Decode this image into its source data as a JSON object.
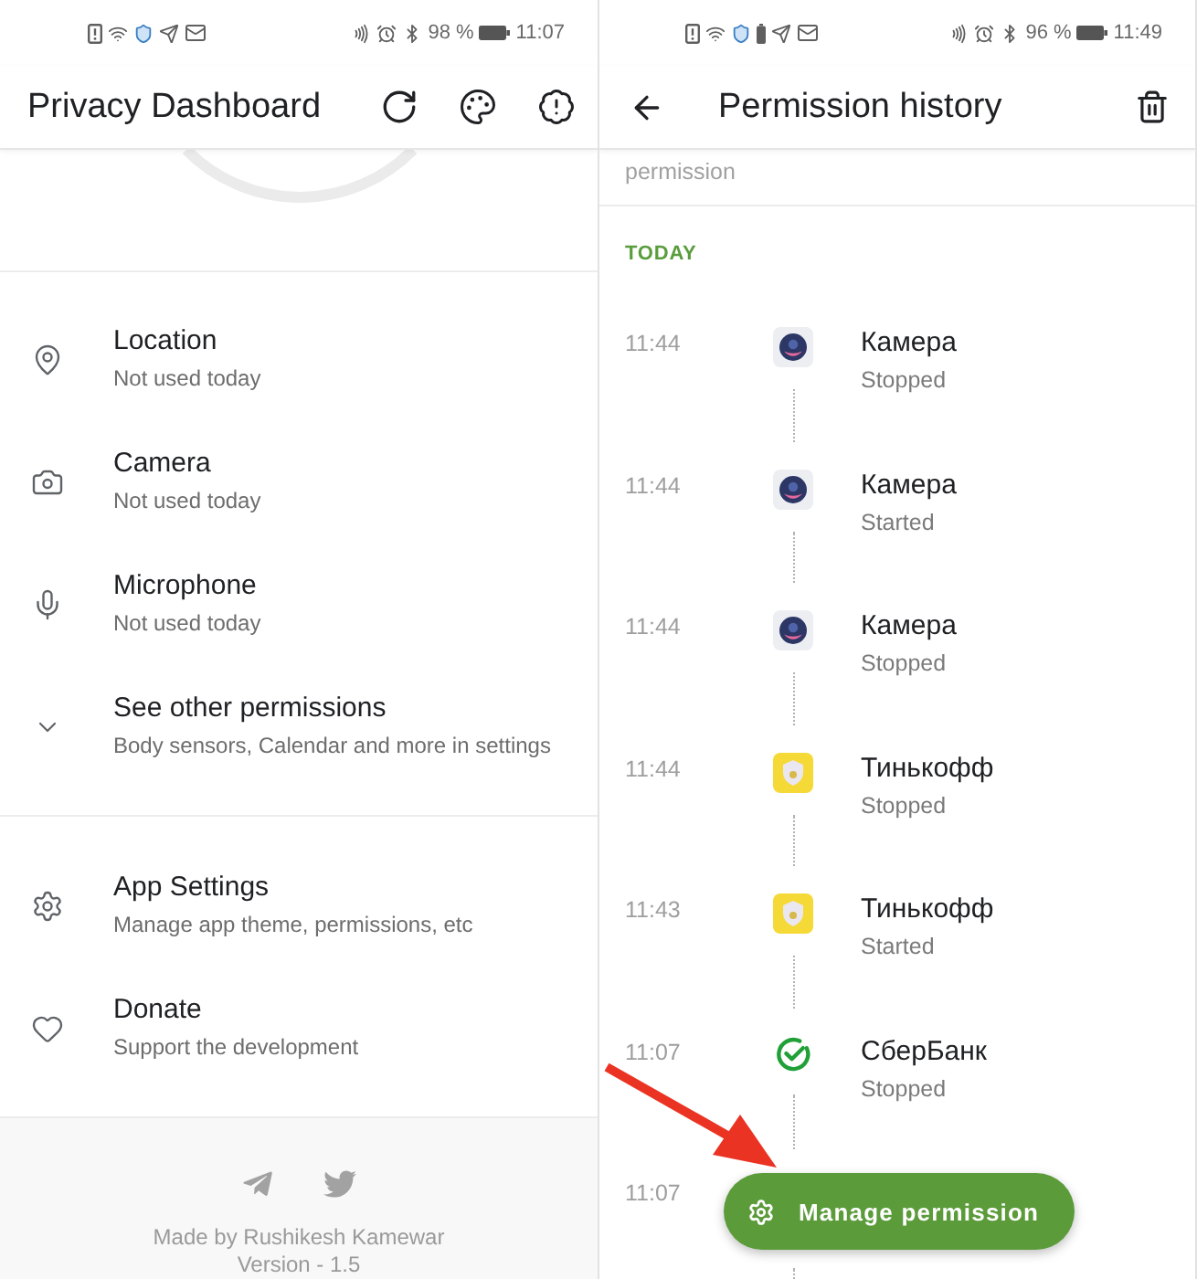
{
  "dashboard": {
    "status_bar": {
      "battery": "98 %",
      "time": "11:07"
    },
    "app_bar": {
      "title": "Privacy Dashboard"
    },
    "permissions": [
      {
        "title": "Location",
        "subtitle": "Not used today"
      },
      {
        "title": "Camera",
        "subtitle": "Not used today"
      },
      {
        "title": "Microphone",
        "subtitle": "Not used today"
      },
      {
        "title": "See other permissions",
        "subtitle": "Body sensors, Calendar and more in settings"
      }
    ],
    "settings": [
      {
        "title": "App Settings",
        "subtitle": "Manage app theme, permissions, etc"
      },
      {
        "title": "Donate",
        "subtitle": "Support the development"
      }
    ],
    "footer": {
      "credit": "Made by Rushikesh Kamewar",
      "version": "Version - 1.5"
    }
  },
  "history": {
    "status_bar": {
      "battery": "96 %",
      "time": "11:49"
    },
    "app_bar": {
      "title": "Permission history"
    },
    "previous_item": {
      "text": "permission"
    },
    "section": "TODAY",
    "events": [
      {
        "time": "11:44",
        "app": "Камера",
        "status": "Stopped"
      },
      {
        "time": "11:44",
        "app": "Камера",
        "status": "Started"
      },
      {
        "time": "11:44",
        "app": "Камера",
        "status": "Stopped"
      },
      {
        "time": "11:44",
        "app": "Тинькофф",
        "status": "Stopped"
      },
      {
        "time": "11:43",
        "app": "Тинькофф",
        "status": "Started"
      },
      {
        "time": "11:07",
        "app": "СберБанк",
        "status": "Stopped"
      },
      {
        "time": "11:07"
      }
    ],
    "fab": {
      "label": "Manage permission"
    }
  }
}
